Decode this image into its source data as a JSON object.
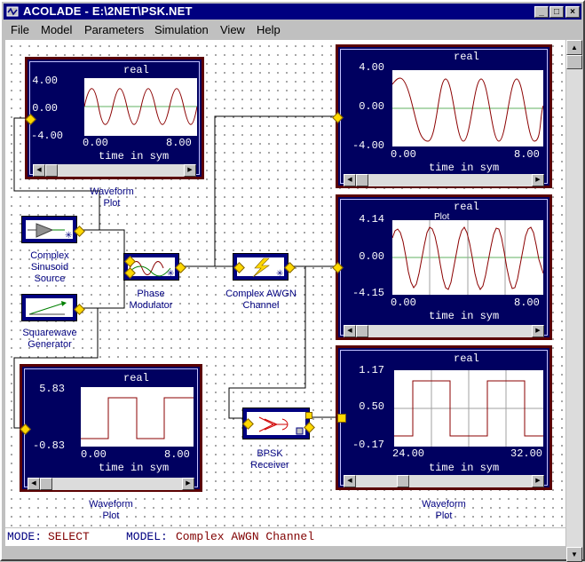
{
  "window": {
    "title": "ACOLADE - E:\\2NET\\PSK.NET",
    "buttons": {
      "minimize": "_",
      "maximize": "□",
      "close": "×"
    }
  },
  "menu": [
    "File",
    "Model",
    "Parameters",
    "Simulation",
    "View",
    "Help"
  ],
  "plots": [
    {
      "id": "plot-1",
      "title": "real",
      "yticks": [
        "4.00",
        "0.00",
        "-4.00"
      ],
      "xticks": [
        "0.00",
        "8.00"
      ],
      "xlabel": "time in sym",
      "caption": "Waveform\nPlot"
    },
    {
      "id": "plot-2",
      "title": "real",
      "yticks": [
        "4.00",
        "0.00",
        "-4.00"
      ],
      "xticks": [
        "0.00",
        "8.00"
      ],
      "xlabel": "time in sym",
      "caption": ""
    },
    {
      "id": "plot-3",
      "title": "real",
      "yticks": [
        "4.14",
        "0.00",
        "-4.15"
      ],
      "xticks": [
        "0.00",
        "8.00"
      ],
      "xlabel": "time in sym",
      "caption": "Plot"
    },
    {
      "id": "plot-4",
      "title": "real",
      "yticks": [
        "5.83",
        "-0.83"
      ],
      "xticks": [
        "0.00",
        "8.00"
      ],
      "xlabel": "time in sym",
      "caption": "Waveform\nPlot"
    },
    {
      "id": "plot-5",
      "title": "real",
      "yticks": [
        "1.17",
        "0.50",
        "-0.17"
      ],
      "xticks": [
        "24.00",
        "32.00"
      ],
      "xlabel": "time in sym",
      "caption": "Waveform\nPlot"
    }
  ],
  "blocks": {
    "sinusoid": "Complex\nSinusoid\nSource",
    "squarewave": "Squarewave\nGenerator",
    "modulator": "Phase\nModulator",
    "awgn": "Complex AWGN\nChannel",
    "receiver": "BPSK\nReceiver"
  },
  "status": {
    "mode_label": "MODE:",
    "mode_value": "SELECT",
    "model_label": "MODEL:",
    "model_value": "Complex AWGN Channel"
  },
  "colors": {
    "title_bar": "#000080",
    "plot_bg": "#000060",
    "plot_frame": "#5a0000",
    "trace": "#8b0000",
    "block": "#000080",
    "port": "#ffd800"
  }
}
